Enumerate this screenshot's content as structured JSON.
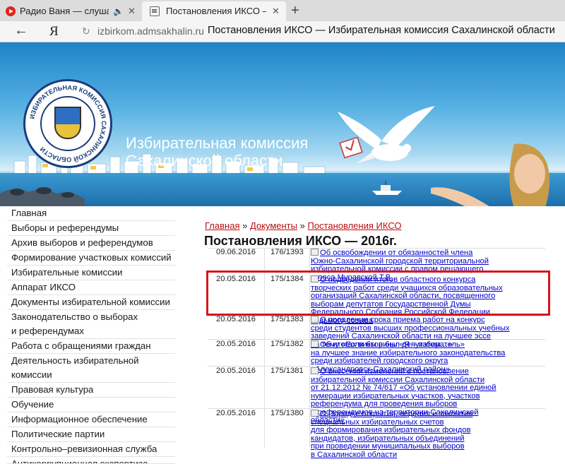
{
  "browser": {
    "tabs": [
      {
        "title": "Радио Ваня — слушат",
        "icon": "youtube-icon"
      },
      {
        "title": "Постановления ИКСО — И",
        "icon": "page-icon"
      }
    ],
    "back_icon": "←",
    "engine_logo": "Я",
    "url_domain": "izbirkom.admsakhalin.ru",
    "url_title": "Постановления ИКСО — Избирательная комиссия Сахалинской области"
  },
  "banner": {
    "org_name_line1": "Избирательная комиссия",
    "org_name_line2": "Сахалинской области",
    "seal_text": "ИЗБИРАТЕЛЬНАЯ КОМИССИЯ САХАЛИНСКОЙ ОБЛАСТИ"
  },
  "sidebar": {
    "items": [
      "Главная",
      "Выборы и референдумы",
      "Архив выборов и референдумов",
      "Формирование участковых комиссий",
      "Избирательные комиссии",
      "Аппарат ИКСО",
      "Документы избирательной комиссии",
      "Законодательство о выборах",
      "и референдумах",
      "Работа с обращениями граждан",
      "Деятельность избирательной",
      "комиссии",
      "Правовая культура",
      "Обучение",
      "Информационное обеспечение",
      "Политические партии",
      "Контрольно–ревизионная служба",
      "Антикоррупционная экспертиза"
    ]
  },
  "breadcrumb": {
    "home": "Главная",
    "sep1": "»",
    "docs": "Документы",
    "sep2": "»",
    "current": "Постановления ИКСО"
  },
  "page_title": "Постановления ИКСО — 2016г.",
  "documents": [
    {
      "date": "09.06.2016",
      "number": "176/1393",
      "lines": [
        "Об освобождении от обязанностей члена",
        "Южно-Сахалинской городской территориальной",
        "избирательной комиссии с правом решающего",
        "голоса Муравской Т.В."
      ]
    },
    {
      "date": "20.05.2016",
      "number": "175/1384",
      "lines": [
        "О подведении итогов областного конкурса",
        "творческих работ среди учащихся образовательных",
        "организаций Сахалинской области, посвященного",
        "выборам депутатов Государственной Думы",
        "Федерального Собрания Российской Федерации",
        "седьмого созыва"
      ]
    },
    {
      "date": "20.05.2016",
      "number": "175/1383",
      "lines": [
        "О продлении срока приема работ на конкурс",
        "среди студентов высших профессиональных учебных",
        "заведений Сахалинской области на лучшее эссе",
        "на тему «Если бы я был депутатом…»"
      ]
    },
    {
      "date": "20.05.2016",
      "number": "175/1382",
      "lines": [
        "Об итогах викторины «Я – избиратель»",
        "на лучшее знание избирательного законодательства",
        "среди избирателей городского округа",
        "«Александровск-Сахалинский район»"
      ]
    },
    {
      "date": "20.05.2016",
      "number": "175/1381",
      "lines": [
        "О внесении изменений в постановление",
        "избирательной комиссии Сахалинской области",
        "от 21.12.2012 № 74/617 «Об установлении единой",
        "нумерации избирательных участков, участков",
        "референдума для проведения выборов",
        "и референдумов на территории Сахалинской",
        "области»"
      ]
    },
    {
      "date": "20.05.2016",
      "number": "175/1380",
      "lines": [
        "О Порядке открытия, ведения и закрытия",
        "специальных избирательных счетов",
        "для формирования избирательных фондов",
        "кандидатов, избирательных объединений",
        "при проведении муниципальных выборов",
        "в Сахалинской области"
      ]
    }
  ]
}
